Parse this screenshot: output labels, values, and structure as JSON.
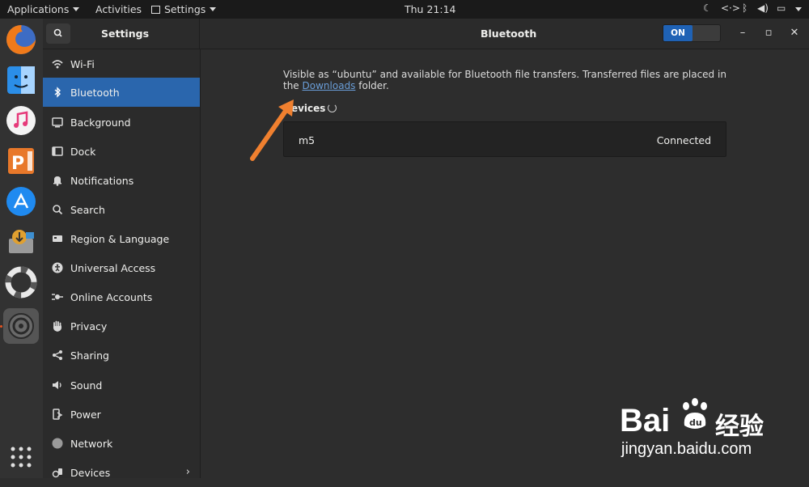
{
  "topbar": {
    "applications": "Applications",
    "activities": "Activities",
    "app_menu": "Settings",
    "clock": "Thu 21:14"
  },
  "dock": {
    "apps": [
      "firefox-icon",
      "finder-icon",
      "music-icon",
      "wps-presentation-icon",
      "app-store-icon",
      "software-updater-icon",
      "help-lifebuoy-icon",
      "settings-icon"
    ],
    "show_apps": "show-applications-icon"
  },
  "header": {
    "sidebar_title": "Settings",
    "panel_title": "Bluetooth",
    "toggle_label": "ON"
  },
  "sidebar": {
    "items": [
      {
        "label": "Wi-Fi",
        "icon": "wifi-icon"
      },
      {
        "label": "Bluetooth",
        "icon": "bluetooth-icon"
      },
      {
        "label": "Background",
        "icon": "background-icon"
      },
      {
        "label": "Dock",
        "icon": "dock-icon"
      },
      {
        "label": "Notifications",
        "icon": "bell-icon"
      },
      {
        "label": "Search",
        "icon": "search-icon"
      },
      {
        "label": "Region & Language",
        "icon": "region-icon"
      },
      {
        "label": "Universal Access",
        "icon": "accessibility-icon"
      },
      {
        "label": "Online Accounts",
        "icon": "online-accounts-icon"
      },
      {
        "label": "Privacy",
        "icon": "hand-icon"
      },
      {
        "label": "Sharing",
        "icon": "share-icon"
      },
      {
        "label": "Sound",
        "icon": "speaker-icon"
      },
      {
        "label": "Power",
        "icon": "power-icon"
      },
      {
        "label": "Network",
        "icon": "network-icon"
      },
      {
        "label": "Devices",
        "icon": "devices-icon"
      }
    ],
    "selected": "Bluetooth"
  },
  "main": {
    "info_prefix": "Visible as “ubuntu” and available for Bluetooth file transfers. Transferred files are placed in the",
    "info_link": "Downloads",
    "info_suffix": "folder.",
    "devices_heading": "Devices",
    "devices": [
      {
        "name": "m5",
        "status": "Connected"
      }
    ]
  },
  "watermark": {
    "brand": "Bai",
    "brand_cn": "经验",
    "url": "jingyan.baidu.com"
  },
  "colors": {
    "accent": "#2a66ad",
    "annotation_arrow": "#f0802f"
  }
}
